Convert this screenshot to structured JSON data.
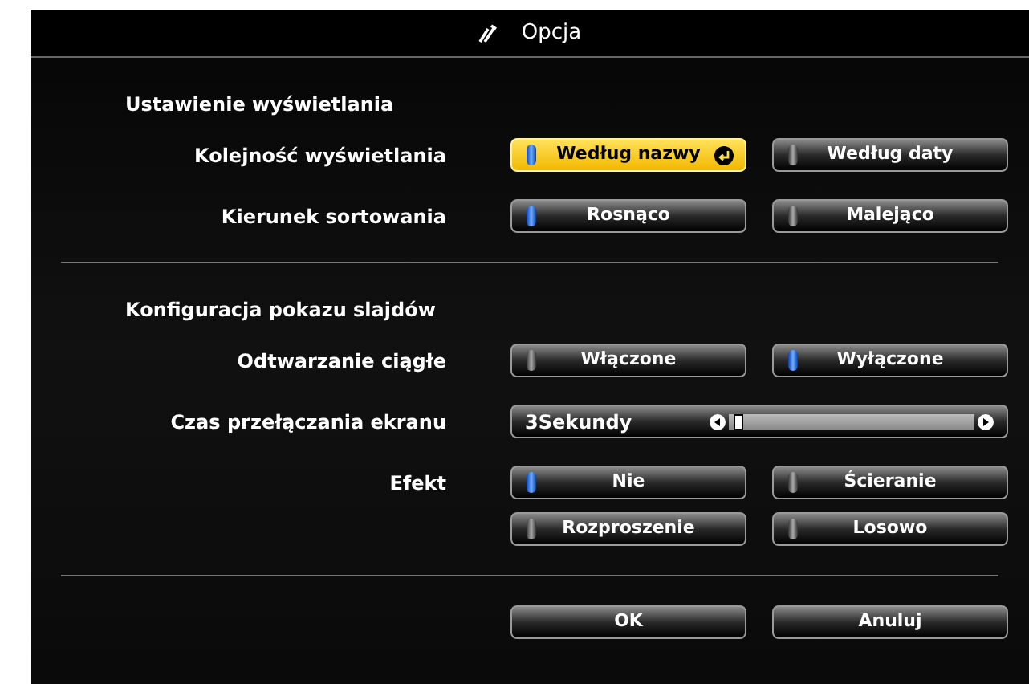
{
  "window": {
    "title": "Opcja"
  },
  "sections": [
    {
      "title": "Ustawienie wyświetlania",
      "rows": [
        {
          "kind": "options",
          "label": "Kolejność wyświetlania",
          "options": [
            {
              "label": "Według nazwy",
              "selected": true,
              "focused": true
            },
            {
              "label": "Według daty",
              "selected": false,
              "focused": false
            }
          ]
        },
        {
          "kind": "options",
          "label": "Kierunek sortowania",
          "options": [
            {
              "label": "Rosnąco",
              "selected": true,
              "focused": false
            },
            {
              "label": "Malejąco",
              "selected": false,
              "focused": false
            }
          ]
        }
      ]
    },
    {
      "title": "Konfiguracja pokazu slajdów",
      "rows": [
        {
          "kind": "options",
          "label": "Odtwarzanie ciągłe",
          "options": [
            {
              "label": "Włączone",
              "selected": false,
              "focused": false
            },
            {
              "label": "Wyłączone",
              "selected": true,
              "focused": false
            }
          ]
        },
        {
          "kind": "slider",
          "label": "Czas przełączania ekranu",
          "value": "3Sekundy",
          "level": 0.02
        },
        {
          "kind": "options",
          "label": "Efekt",
          "options": [
            {
              "label": "Nie",
              "selected": true,
              "focused": false
            },
            {
              "label": "Ścieranie",
              "selected": false,
              "focused": false
            },
            {
              "label": "Rozproszenie",
              "selected": false,
              "focused": false
            },
            {
              "label": "Losowo",
              "selected": false,
              "focused": false
            }
          ]
        }
      ]
    }
  ],
  "buttons": [
    {
      "label": "OK"
    },
    {
      "label": "Anuluj"
    }
  ]
}
